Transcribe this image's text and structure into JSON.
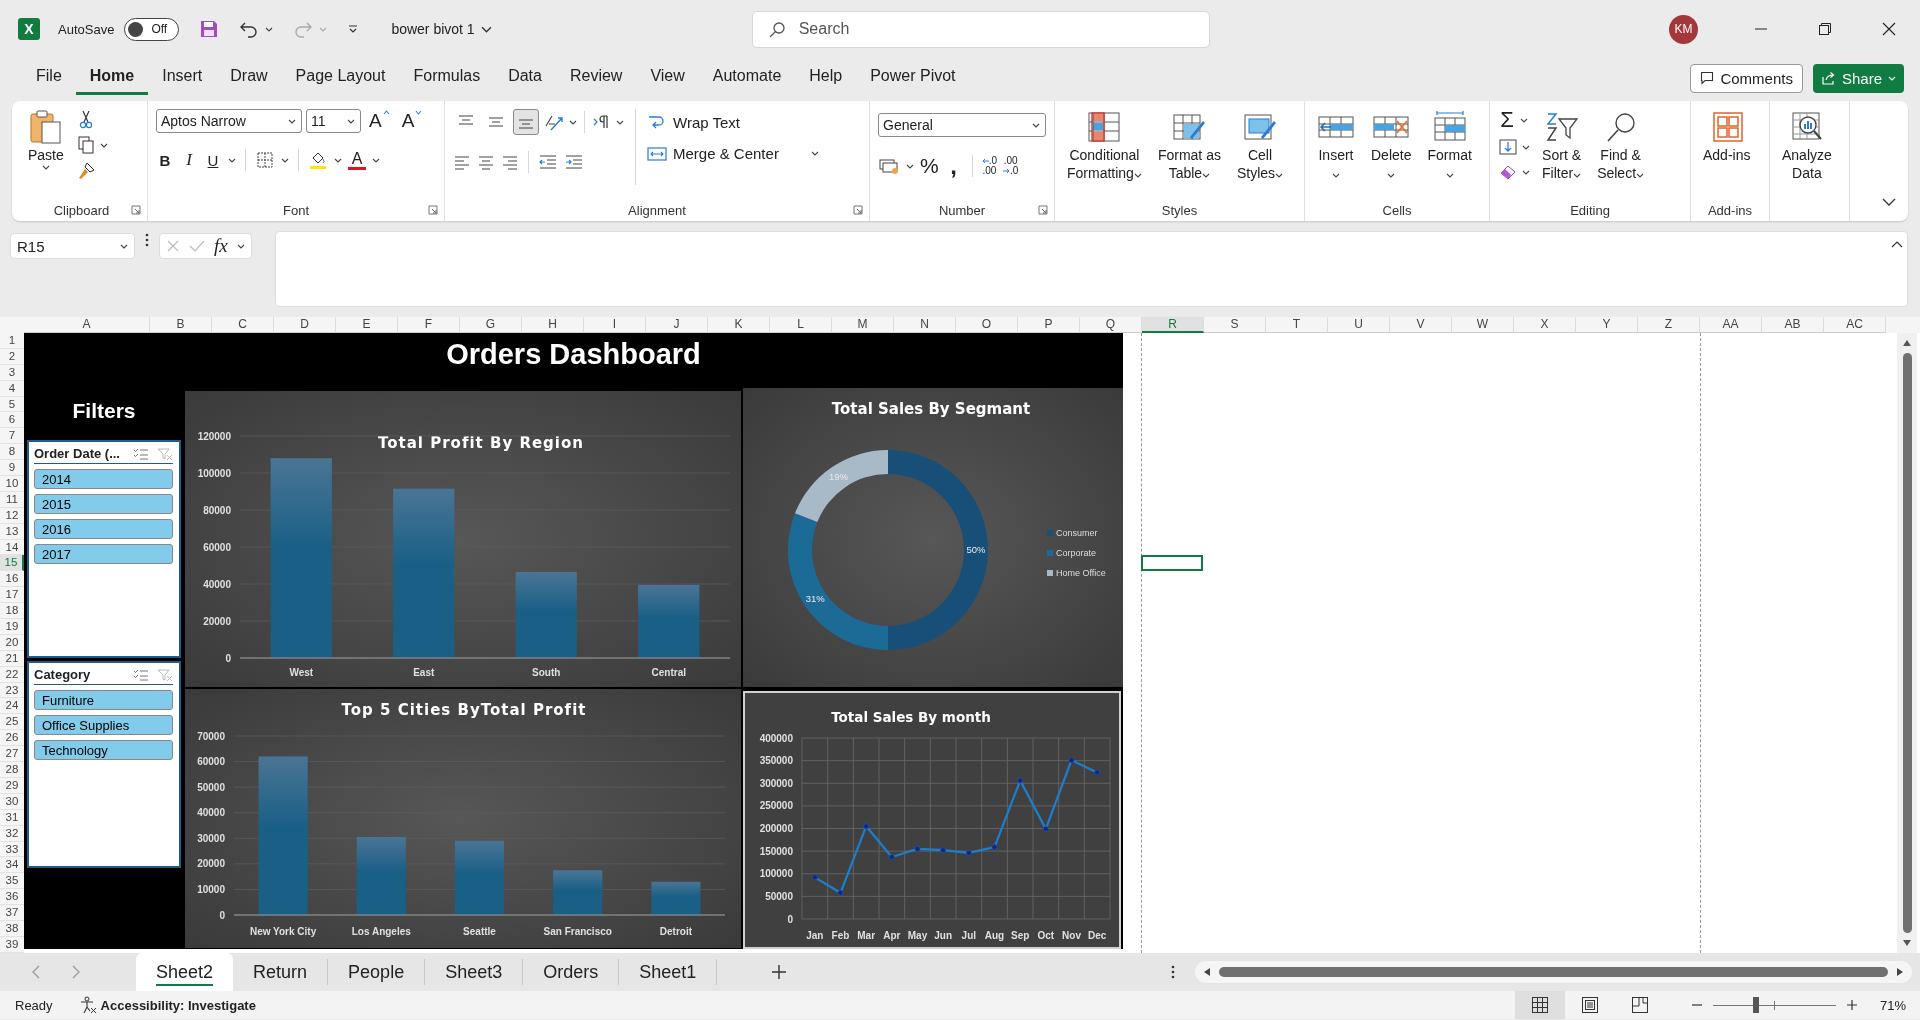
{
  "title_bar": {
    "logo_letter": "X",
    "autosave": {
      "label": "AutoSave",
      "on": false,
      "state": "Off"
    },
    "file_name": "bower bivot 1",
    "search": {
      "placeholder": "Search"
    },
    "user_initials": "KM"
  },
  "menu": [
    {
      "label": "File",
      "selected": false
    },
    {
      "label": "Home",
      "selected": true
    },
    {
      "label": "Insert",
      "selected": false
    },
    {
      "label": "Draw",
      "selected": false
    },
    {
      "label": "Page Layout",
      "selected": false
    },
    {
      "label": "Formulas",
      "selected": false
    },
    {
      "label": "Data",
      "selected": false
    },
    {
      "label": "Review",
      "selected": false
    },
    {
      "label": "View",
      "selected": false
    },
    {
      "label": "Automate",
      "selected": false
    },
    {
      "label": "Help",
      "selected": false
    },
    {
      "label": "Power Pivot",
      "selected": false
    }
  ],
  "comments_button": "Comments",
  "share_button": "Share",
  "ribbon": {
    "groups": [
      {
        "kind": "clipboard",
        "label": "Clipboard",
        "paste": "Paste",
        "launcher": true
      },
      {
        "kind": "font",
        "label": "Font",
        "font_name": "Aptos Narrow",
        "font_size": "11",
        "grow": "A",
        "shrink": "A",
        "bold": "B",
        "italic": "I",
        "underline": "U",
        "font_color": "A",
        "launcher": true
      },
      {
        "kind": "alignment",
        "label": "Alignment",
        "vertical_align": [
          {
            "kind": "top",
            "selected": false
          },
          {
            "kind": "middle",
            "selected": false
          },
          {
            "kind": "bottom",
            "selected": true
          }
        ],
        "wrap_text": "Wrap Text",
        "merge": "Merge & Center",
        "launcher": true
      },
      {
        "kind": "number",
        "label": "Number",
        "format": "General",
        "percent": "%",
        "comma": ",",
        "increase_decimal": [
          ".0",
          ".00"
        ],
        "decrease_decimal": [
          ".00",
          ".0"
        ],
        "launcher": true
      },
      {
        "kind": "big",
        "label": "Styles",
        "buttons": [
          {
            "lines": [
              "Conditional",
              "Formatting"
            ]
          },
          {
            "lines": [
              "Format as",
              "Table"
            ]
          },
          {
            "lines": [
              "Cell",
              "Styles"
            ]
          }
        ]
      },
      {
        "kind": "big",
        "label": "Cells",
        "buttons": [
          {
            "lines": [
              "Insert"
            ]
          },
          {
            "lines": [
              "Delete"
            ]
          },
          {
            "lines": [
              "Format"
            ]
          }
        ]
      },
      {
        "kind": "editing",
        "label": "Editing",
        "sum": "Σ",
        "buttons": [
          {
            "lines": [
              "Sort &",
              "Filter"
            ]
          },
          {
            "lines": [
              "Find &",
              "Select"
            ]
          }
        ]
      },
      {
        "kind": "big",
        "label": "Add-ins",
        "buttons": [
          {
            "lines": [
              "Add-ins"
            ]
          }
        ]
      },
      {
        "kind": "big",
        "buttons": [
          {
            "lines": [
              "Analyze",
              "Data"
            ]
          }
        ]
      }
    ]
  },
  "formula_bar": {
    "name_box": "R15",
    "fx": "fx"
  },
  "sheet": {
    "columns": [
      {
        "label": "A",
        "selected": false
      },
      {
        "label": "B",
        "selected": false
      },
      {
        "label": "C",
        "selected": false
      },
      {
        "label": "D",
        "selected": false
      },
      {
        "label": "E",
        "selected": false
      },
      {
        "label": "F",
        "selected": false
      },
      {
        "label": "G",
        "selected": false
      },
      {
        "label": "H",
        "selected": false
      },
      {
        "label": "I",
        "selected": false
      },
      {
        "label": "J",
        "selected": false
      },
      {
        "label": "K",
        "selected": false
      },
      {
        "label": "L",
        "selected": false
      },
      {
        "label": "M",
        "selected": false
      },
      {
        "label": "N",
        "selected": false
      },
      {
        "label": "O",
        "selected": false
      },
      {
        "label": "P",
        "selected": false
      },
      {
        "label": "Q",
        "selected": false
      },
      {
        "label": "R",
        "selected": true
      },
      {
        "label": "S",
        "selected": false
      },
      {
        "label": "T",
        "selected": false
      },
      {
        "label": "U",
        "selected": false
      },
      {
        "label": "V",
        "selected": false
      },
      {
        "label": "W",
        "selected": false
      },
      {
        "label": "X",
        "selected": false
      },
      {
        "label": "Y",
        "selected": false
      },
      {
        "label": "Z",
        "selected": false
      },
      {
        "label": "AA",
        "selected": false
      },
      {
        "label": "AB",
        "selected": false
      },
      {
        "label": "AC",
        "selected": false
      }
    ],
    "rows": [
      {
        "label": "1",
        "selected": false
      },
      {
        "label": "2",
        "selected": false
      },
      {
        "label": "3",
        "selected": false
      },
      {
        "label": "4",
        "selected": false
      },
      {
        "label": "5",
        "selected": false
      },
      {
        "label": "6",
        "selected": false
      },
      {
        "label": "7",
        "selected": false
      },
      {
        "label": "8",
        "selected": false
      },
      {
        "label": "9",
        "selected": false
      },
      {
        "label": "10",
        "selected": false
      },
      {
        "label": "11",
        "selected": false
      },
      {
        "label": "12",
        "selected": false
      },
      {
        "label": "13",
        "selected": false
      },
      {
        "label": "14",
        "selected": false
      },
      {
        "label": "15",
        "selected": true
      },
      {
        "label": "16",
        "selected": false
      },
      {
        "label": "17",
        "selected": false
      },
      {
        "label": "18",
        "selected": false
      },
      {
        "label": "19",
        "selected": false
      },
      {
        "label": "20",
        "selected": false
      },
      {
        "label": "21",
        "selected": false
      },
      {
        "label": "22",
        "selected": false
      },
      {
        "label": "23",
        "selected": false
      },
      {
        "label": "24",
        "selected": false
      },
      {
        "label": "25",
        "selected": false
      },
      {
        "label": "26",
        "selected": false
      },
      {
        "label": "27",
        "selected": false
      },
      {
        "label": "28",
        "selected": false
      },
      {
        "label": "29",
        "selected": false
      },
      {
        "label": "30",
        "selected": false
      },
      {
        "label": "31",
        "selected": false
      },
      {
        "label": "32",
        "selected": false
      },
      {
        "label": "33",
        "selected": false
      },
      {
        "label": "34",
        "selected": false
      },
      {
        "label": "35",
        "selected": false
      },
      {
        "label": "36",
        "selected": false
      },
      {
        "label": "37",
        "selected": false
      },
      {
        "label": "38",
        "selected": false
      },
      {
        "label": "39",
        "selected": false
      }
    ]
  },
  "dashboard": {
    "title": "Orders Dashboard",
    "filters_label": "Filters",
    "slicers": [
      {
        "title": "Order Date (...",
        "items": [
          {
            "label": "2014",
            "selected": true
          },
          {
            "label": "2015",
            "selected": true
          },
          {
            "label": "2016",
            "selected": true
          },
          {
            "label": "2017",
            "selected": true
          }
        ]
      },
      {
        "title": "Category",
        "items": [
          {
            "label": "Furniture",
            "selected": true
          },
          {
            "label": "Office Supplies",
            "selected": true
          },
          {
            "label": "Technology",
            "selected": true
          }
        ]
      }
    ],
    "charts": [
      {
        "chart_data": {
          "type": "bar",
          "title": "Total Profit By Region",
          "categories": [
            "West",
            "East",
            "South",
            "Central"
          ],
          "series": [
            {
              "color": "#1a5f86",
              "values": [
                108000,
                91500,
                46500,
                39500
              ]
            }
          ],
          "grid": true,
          "ylim": [
            0,
            120000
          ],
          "yticks": [
            0,
            20000,
            40000,
            60000,
            80000,
            100000,
            120000
          ]
        }
      },
      {
        "chart_data": {
          "type": "donut",
          "title": "Total Sales By Segmant",
          "categories": [
            "Consumer",
            "Corporate",
            "Home Office"
          ],
          "values": [
            50,
            31,
            19
          ],
          "colors": [
            "#174f78",
            "#1c6b97",
            "#a8b9c7"
          ],
          "value_labels": [
            "50%",
            "31%",
            "19%"
          ],
          "legend": "right"
        }
      },
      {
        "chart_data": {
          "type": "bar",
          "title": "Top 5 Cities ByTotal Profit",
          "categories": [
            "New York City",
            "Los Angeles",
            "Seattle",
            "San Francisco",
            "Detroit"
          ],
          "series": [
            {
              "color": "#1a5f86",
              "values": [
                62000,
                30500,
                29000,
                17500,
                13000
              ]
            }
          ],
          "grid": true,
          "ylim": [
            0,
            70000
          ],
          "yticks": [
            0,
            10000,
            20000,
            30000,
            40000,
            50000,
            60000,
            70000
          ]
        }
      },
      {
        "chart_data": {
          "type": "line",
          "title": "Total Sales By month",
          "categories": [
            "Jan",
            "Feb",
            "Mar",
            "Apr",
            "May",
            "Jun",
            "Jul",
            "Aug",
            "Sep",
            "Oct",
            "Nov",
            "Dec"
          ],
          "series": [
            {
              "color": "#1b7fd0",
              "marker": "circle",
              "values": [
                92000,
                58000,
                205000,
                137000,
                155000,
                152000,
                146000,
                159000,
                306000,
                199000,
                351000,
                324000
              ]
            }
          ],
          "grid": true,
          "ylim": [
            0,
            400000
          ],
          "yticks": [
            0,
            50000,
            100000,
            150000,
            200000,
            250000,
            300000,
            350000,
            400000
          ]
        }
      }
    ]
  },
  "sheet_tabs": [
    {
      "label": "Sheet2",
      "selected": true
    },
    {
      "label": "Return",
      "selected": false
    },
    {
      "label": "People",
      "selected": false
    },
    {
      "label": "Sheet3",
      "selected": false
    },
    {
      "label": "Orders",
      "selected": false
    },
    {
      "label": "Sheet1",
      "selected": false
    }
  ],
  "status_bar": {
    "ready": "Ready",
    "accessibility": "Accessibility: Investigate",
    "views": [
      {
        "kind": "normal",
        "selected": true
      },
      {
        "kind": "page_layout",
        "selected": false
      },
      {
        "kind": "page_break",
        "selected": false
      }
    ],
    "zoom": {
      "level": 0.35,
      "reading": "71%"
    }
  }
}
